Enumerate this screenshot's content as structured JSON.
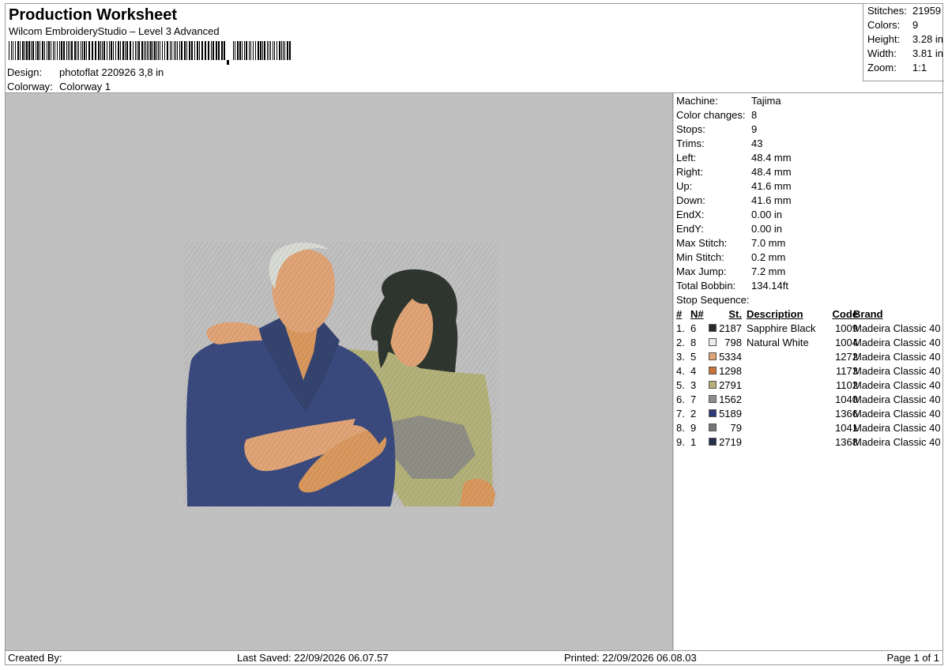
{
  "header": {
    "title": "Production Worksheet",
    "subtitle": "Wilcom EmbroideryStudio – Level 3 Advanced",
    "design_label": "Design:",
    "design_value": "photoflat 220926 3,8 in",
    "colorway_label": "Colorway:",
    "colorway_value": "Colorway 1"
  },
  "summary": [
    {
      "label": "Stitches:",
      "value": "21959"
    },
    {
      "label": "Colors:",
      "value": "9"
    },
    {
      "label": "Height:",
      "value": "3.28 in"
    },
    {
      "label": "Width:",
      "value": "3.81 in"
    },
    {
      "label": "Zoom:",
      "value": "1:1"
    }
  ],
  "stats": [
    {
      "label": "Machine:",
      "value": "Tajima"
    },
    {
      "label": "Color changes:",
      "value": "8"
    },
    {
      "label": "Stops:",
      "value": "9"
    },
    {
      "label": "Trims:",
      "value": "43"
    },
    {
      "label": "Left:",
      "value": "48.4 mm"
    },
    {
      "label": "Right:",
      "value": "48.4 mm"
    },
    {
      "label": "Up:",
      "value": "41.6 mm"
    },
    {
      "label": "Down:",
      "value": "41.6 mm"
    },
    {
      "label": "EndX:",
      "value": "0.00 in"
    },
    {
      "label": "EndY:",
      "value": "0.00 in"
    },
    {
      "label": "Max Stitch:",
      "value": "7.0 mm"
    },
    {
      "label": "Min Stitch:",
      "value": "0.2 mm"
    },
    {
      "label": "Max Jump:",
      "value": "7.2 mm"
    },
    {
      "label": "Total Bobbin:",
      "value": "134.14ft"
    }
  ],
  "stop_sequence": {
    "label": "Stop Sequence:",
    "headers": {
      "num": "#",
      "n": "N#",
      "st": "St.",
      "desc": "Description",
      "code": "Code",
      "brand": "Brand"
    },
    "rows": [
      {
        "num": "1.",
        "n": "6",
        "color": "#2a2a2e",
        "st": "2187",
        "desc": "Sapphire Black",
        "code": "1009",
        "brand": "Madeira Classic 40"
      },
      {
        "num": "2.",
        "n": "8",
        "color": "#ececea",
        "st": "798",
        "desc": "Natural White",
        "code": "1004",
        "brand": "Madeira Classic 40"
      },
      {
        "num": "3.",
        "n": "5",
        "color": "#e0a476",
        "st": "5334",
        "desc": "",
        "code": "1272",
        "brand": "Madeira Classic 40"
      },
      {
        "num": "4.",
        "n": "4",
        "color": "#c8743a",
        "st": "1298",
        "desc": "",
        "code": "1173",
        "brand": "Madeira Classic 40"
      },
      {
        "num": "5.",
        "n": "3",
        "color": "#b6b07a",
        "st": "2791",
        "desc": "",
        "code": "1102",
        "brand": "Madeira Classic 40"
      },
      {
        "num": "6.",
        "n": "7",
        "color": "#8e8e8e",
        "st": "1562",
        "desc": "",
        "code": "1040",
        "brand": "Madeira Classic 40"
      },
      {
        "num": "7.",
        "n": "2",
        "color": "#2e3a78",
        "st": "5189",
        "desc": "",
        "code": "1366",
        "brand": "Madeira Classic 40"
      },
      {
        "num": "8.",
        "n": "9",
        "color": "#767676",
        "st": "79",
        "desc": "",
        "code": "1041",
        "brand": "Madeira Classic 40"
      },
      {
        "num": "9.",
        "n": "1",
        "color": "#24304a",
        "st": "2719",
        "desc": "",
        "code": "1368",
        "brand": "Madeira Classic 40"
      }
    ]
  },
  "footer": {
    "created_by": "Created By:",
    "last_saved": "Last Saved: 22/09/2026 06.07.57",
    "printed": "Printed: 22/09/2026 06.08.03",
    "page": "Page 1 of 1"
  }
}
